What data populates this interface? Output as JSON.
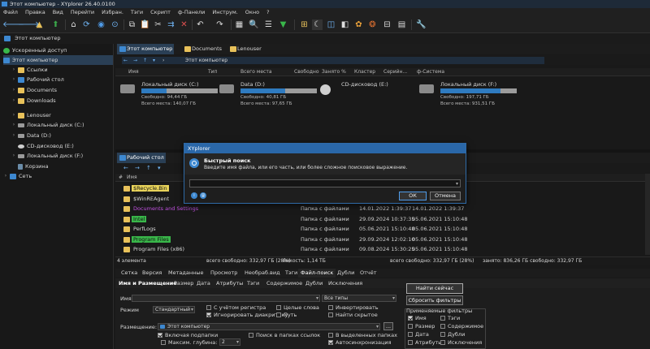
{
  "window": {
    "title": "Этот компьютер - XYplorer 26.40.0100"
  },
  "menu": [
    "Файл",
    "Правка",
    "Вид",
    "Перейти",
    "Избран.",
    "Тэги",
    "Скрипт",
    "ф-Панели",
    "Инструм.",
    "Окно",
    "?"
  ],
  "address": {
    "path": "Этот компьютер"
  },
  "tree": {
    "items": [
      {
        "label": "Ускоренный доступ",
        "icon": "star-icon"
      },
      {
        "label": "Этот компьютер",
        "icon": "computer-icon",
        "selected": true
      },
      {
        "label": "Ссылки",
        "icon": "folder-icon"
      },
      {
        "label": "Рабочий стол",
        "icon": "folder-icon"
      },
      {
        "label": "Documents",
        "icon": "folder-icon"
      },
      {
        "label": "Downloads",
        "icon": "folder-icon"
      },
      {
        "label": "Lenouser",
        "icon": "folder-icon"
      },
      {
        "label": "Локальный диск (C:)",
        "icon": "drive-icon"
      },
      {
        "label": "Data (D:)",
        "icon": "drive-icon"
      },
      {
        "label": "CD-дисковод (E:)",
        "icon": "cd-icon"
      },
      {
        "label": "Локальный диск (F:)",
        "icon": "drive-icon"
      },
      {
        "label": "Корзина",
        "icon": "recycle-bin-icon"
      },
      {
        "label": "Сеть",
        "icon": "network-icon"
      }
    ]
  },
  "pane1": {
    "tabs": [
      "Этот компьютер",
      "Documents",
      "Lenouser"
    ],
    "breadcrumb": "Этот компьютер",
    "columns": [
      "Имя",
      "Тип",
      "Всего места",
      "Свободно",
      "Занято %",
      "Кластер",
      "Серийн...",
      "ф-Система"
    ],
    "drives": [
      {
        "name": "Локальный диск (C:)",
        "free": "Свободно: 94,44 ГБ",
        "total": "Всего места: 140,07 ГБ",
        "used_fraction": 0.33
      },
      {
        "name": "Data (D:)",
        "free": "Свободно: 40,81 ГБ",
        "total": "Всего места: 97,65 ГБ",
        "used_fraction": 0.58
      },
      {
        "name": "CD-дисковод (E:)",
        "free": "",
        "total": "",
        "used_fraction": null
      },
      {
        "name": "Локальный диск (F:)",
        "free": "Свободно: 197,71 ГБ",
        "total": "Всего места: 931,51 ГБ",
        "used_fraction": 0.79
      }
    ]
  },
  "pane2": {
    "tabs": [
      "Рабочий стол"
    ],
    "columns": [
      "Имя"
    ],
    "files": [
      {
        "name": "$Recycle.Bin",
        "type": "",
        "date": "",
        "date2": "",
        "highlight": "#e8d35a"
      },
      {
        "name": "$WinREAgent",
        "type": "",
        "date": "",
        "date2": "",
        "highlight": ""
      },
      {
        "name": "Documents and Settings",
        "type": "Папка с файлами",
        "date": "14.01.2022 1:39:37",
        "date2": "14.01.2022 1:39:37",
        "highlight": "#a63fc0"
      },
      {
        "name": "Intel",
        "type": "Папка с файлами",
        "date": "29.09.2024 10:37:35",
        "date2": "05.06.2021 15:10:48",
        "highlight": "#39b74a"
      },
      {
        "name": "PerfLogs",
        "type": "Папка с файлами",
        "date": "05.06.2021 15:10:48",
        "date2": "05.06.2021 15:10:48",
        "highlight": ""
      },
      {
        "name": "Program Files",
        "type": "Папка с файлами",
        "date": "29.09.2024 12:02:10",
        "date2": "05.06.2021 15:10:48",
        "highlight": "#39b74a"
      },
      {
        "name": "Program Files (x86)",
        "type": "Папка с файлами",
        "date": "09.08.2024 15:30:25",
        "date2": "05.06.2021 15:10:48",
        "highlight": ""
      }
    ]
  },
  "status": {
    "count": "4 элемента",
    "free": "всего  свободно: 332,97 ГБ (28%)",
    "capacity": "ёмкость: 1,14 ТБ",
    "right": "всего  свободно: 332,97 ГБ (28%)",
    "used": "занято: 836,26 ГБ  свободно: 332,97 ГБ"
  },
  "bottom": {
    "tabs": [
      "Сетка",
      "Версия",
      "Метаданные",
      "Просмотр",
      "Необраб.вид",
      "Тэги",
      "Файл-поиск",
      "Дубли",
      "Отчёт"
    ],
    "subtabs": [
      "Имя и Размещение",
      "Размер",
      "Дата",
      "Атрибуты",
      "Тэги",
      "Содержимое",
      "Дубли",
      "Исключения"
    ],
    "name_label": "Имя",
    "type_value": "Все типы",
    "mode_label": "Режим",
    "mode_value": "Стандартный",
    "checks": {
      "case": "С учётом регистра",
      "diacritics": "Игнорировать диакритику",
      "whole": "Целые слова",
      "path": "Путь",
      "invert": "Инвертировать",
      "hidden": "Найти скрытое"
    },
    "location_label": "Размещение:",
    "location_value": "Этот компьютер",
    "subfolders": "Включая подпапки",
    "maxdepth": "Максим. глубина:",
    "depth_value": "2",
    "links": "Поиск в папках ссылок",
    "selected": "В выделенных папках",
    "autosync": "Автосинхронизация",
    "browse": "...",
    "find_now": "Найти сейчас",
    "reset": "Сбросить фильтры",
    "applied_title": "Применяемые фильтры",
    "filters": [
      "Имя",
      "Тэги",
      "Размер",
      "Содержимое",
      "Дата",
      "Дубли",
      "Атрибуты",
      "Исключения"
    ]
  },
  "dialog": {
    "title": "XYplorer",
    "heading": "Быстрый поиск",
    "hint": "Введите имя файла, или его часть, или более сложное поисковое выражение.",
    "ok": "ОК",
    "cancel": "Отмена",
    "input_value": ""
  }
}
